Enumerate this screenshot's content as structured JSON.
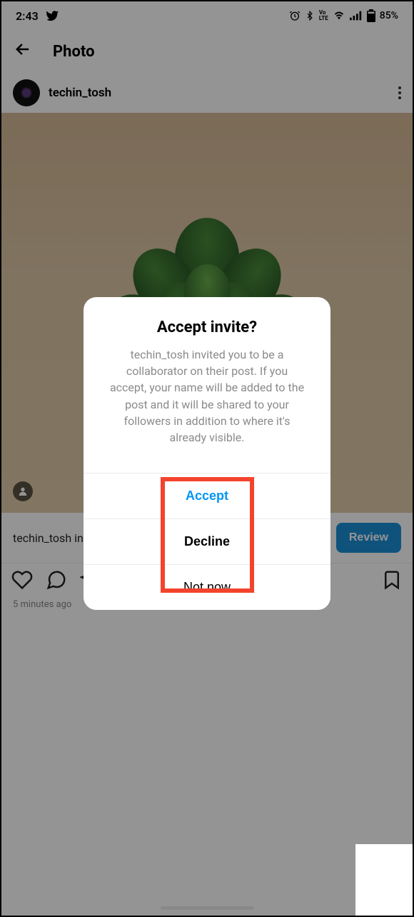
{
  "status_bar": {
    "time": "2:43",
    "battery": "85%",
    "lte_label": "Vo\nLTE"
  },
  "header": {
    "title": "Photo"
  },
  "user": {
    "name": "techin_tosh"
  },
  "invite_row": {
    "text": "techin_tosh in",
    "review_label": "Review"
  },
  "timestamp": "5 minutes ago",
  "dialog": {
    "title": "Accept invite?",
    "body": "techin_tosh invited you to be a collaborator on their post. If you accept, your name will be added to the post and it will be shared to your followers in addition to where it's already visible.",
    "accept_label": "Accept",
    "decline_label": "Decline",
    "not_now_label": "Not now"
  }
}
